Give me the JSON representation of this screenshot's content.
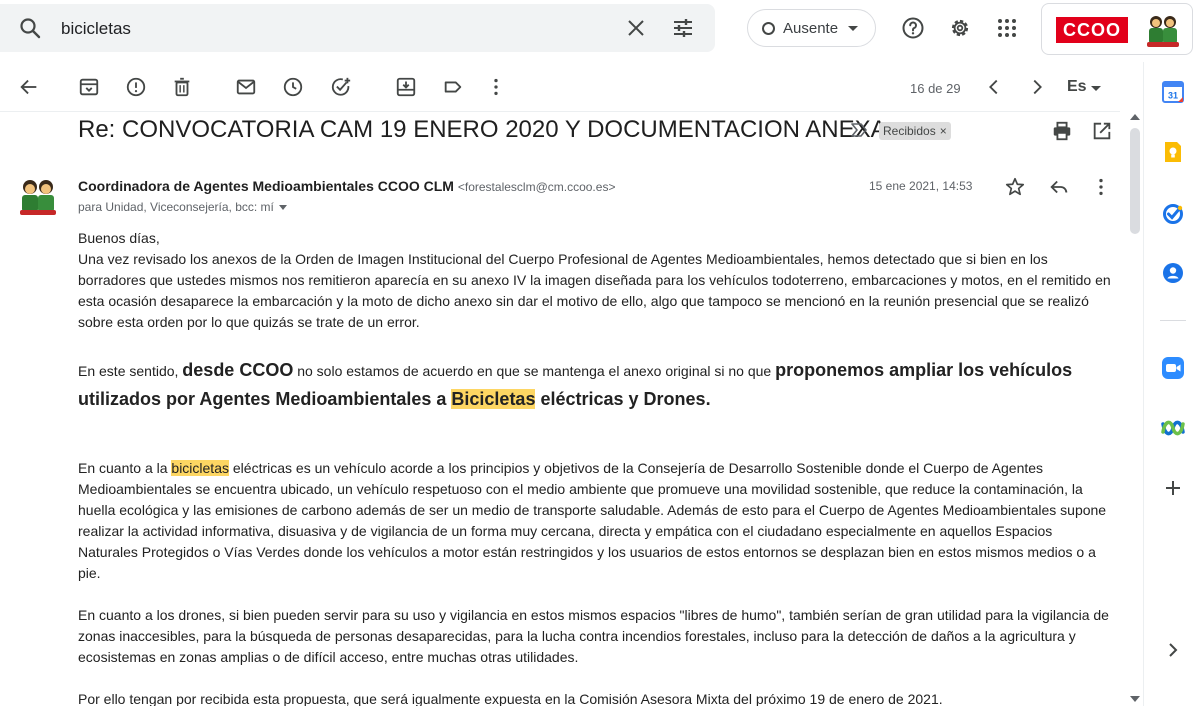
{
  "search": {
    "query": "bicicletas"
  },
  "status": {
    "label": "Ausente"
  },
  "brand": {
    "logo_text": "CCOO"
  },
  "toolbar": {
    "counter": "16 de 29",
    "language": "Es"
  },
  "email": {
    "subject": "Re: CONVOCATORIA CAM 19 ENERO 2020 Y DOCUMENTACION ANEXA",
    "label_chip": "Recibidos",
    "label_close": "×",
    "sender_name": "Coordinadora de Agentes Medioambientales CCOO CLM",
    "sender_email": "<forestalesclm@cm.ccoo.es>",
    "recipients": "para Unidad, Viceconsejería, bcc: mí",
    "date": "15 ene 2021, 14:53",
    "body": {
      "greeting": "Buenos días,",
      "p1": "Una vez revisado los anexos de la Orden de Imagen Institucional del Cuerpo Profesional de Agentes Medioambientales, hemos detectado que si bien en los borradores que ustedes mismos nos remitieron aparecía en su anexo IV la imagen diseñada para los vehículos todoterreno, embarcaciones y motos, en el remitido en esta ocasión desaparece la embarcación y la moto de dicho anexo sin dar el motivo de ello, algo que tampoco se mencionó en la reunión presencial que se realizó sobre esta orden por lo que quizás se trate de un error.",
      "p2_a": "En este sentido, ",
      "p2_b": "desde CCOO",
      "p2_c": " no solo estamos de acuerdo en que se mantenga el anexo original si no que ",
      "p2_d": " proponemos ampliar los vehículos utilizados por Agentes Medioambientales a ",
      "p2_e": "Bicicletas",
      "p2_f": " eléctricas y Drones.",
      "p3_a": "En cuanto a la ",
      "p3_b": "bicicletas",
      "p3_c": " eléctricas es un vehículo acorde a los principios y objetivos de la Consejería de Desarrollo Sostenible donde el Cuerpo de Agentes Medioambientales se encuentra ubicado, un vehículo respetuoso con el medio ambiente que promueve una movilidad sostenible, que reduce la contaminación, la huella ecológica y las emisiones de carbono además de ser un medio de transporte saludable. Además de esto para el Cuerpo de Agentes Medioambientales supone realizar la actividad informativa, disuasiva y de vigilancia de un forma muy cercana, directa y empática con el ciudadano especialmente en aquellos Espacios Naturales Protegidos o Vías Verdes donde los vehículos a motor están restringidos y los usuarios de estos entornos se desplazan bien en estos mismos medios o a pie.",
      "p4": "En cuanto a los drones, si bien pueden servir para su uso y vigilancia en estos mismos espacios \"libres de humo\", también serían de gran utilidad para la vigilancia de zonas inaccesibles, para la búsqueda de personas desaparecidas, para la lucha contra incendios forestales, incluso para la detección de daños a la agricultura y ecosistemas en zonas amplias o de difícil acceso, entre muchas otras utilidades.",
      "p5": "Por ello tengan por recibida esta propuesta, que será igualmente expuesta en la Comisión Asesora Mixta del próximo 19 de enero de 2021."
    }
  },
  "icons": {
    "search": "search-icon",
    "clear": "close-icon",
    "tune": "tune-icon",
    "help": "help-icon",
    "settings": "gear-icon",
    "apps": "apps-grid-icon",
    "calendar": "calendar-icon",
    "calendar_day": "31",
    "keep": "keep-icon",
    "tasks": "tasks-icon",
    "contacts": "contacts-icon",
    "zoom": "zoom-icon",
    "webex": "webex-icon",
    "add": "add-icon",
    "expand": "chevron-right-icon"
  },
  "colors": {
    "highlight": "#fdd663",
    "brand_red": "#e2001a",
    "search_bg": "#f1f3f4"
  }
}
